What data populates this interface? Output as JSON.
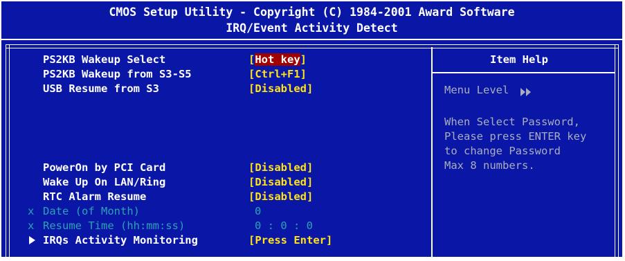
{
  "header": {
    "title": "CMOS Setup Utility - Copyright (C) 1984-2001 Award Software",
    "subtitle": "IRQ/Event Activity Detect"
  },
  "settings": [
    {
      "label": "PS2KB Wakeup Select",
      "value_open": "[",
      "value": "Hot key",
      "value_close": "]"
    },
    {
      "label": "PS2KB Wakeup from S3-S5",
      "value": "[Ctrl+F1]"
    },
    {
      "label": "USB Resume from S3",
      "value": "[Disabled]"
    },
    {
      "label": "PowerOn by PCI Card",
      "value": "[Disabled]"
    },
    {
      "label": "Wake Up On LAN/Ring",
      "value": "[Disabled]"
    },
    {
      "label": "RTC Alarm Resume",
      "value": "[Disabled]"
    },
    {
      "prefix": "x",
      "label": "Date (of Month)",
      "value": "0"
    },
    {
      "prefix": "x",
      "label": "Resume Time (hh:mm:ss)",
      "value": "0 : 0 : 0"
    },
    {
      "label": "IRQs Activity Monitoring",
      "value": "[Press Enter]"
    }
  ],
  "help": {
    "title": "Item Help",
    "menu_level": "Menu Level",
    "lines": [
      "When Select Password,",
      "Please press ENTER key",
      "to change Password",
      "Max 8 numbers."
    ]
  },
  "colors": {
    "background": "#0a17a6",
    "value": "#ffe21a",
    "disabled": "#2ba2b3",
    "highlight": "#a00000"
  }
}
